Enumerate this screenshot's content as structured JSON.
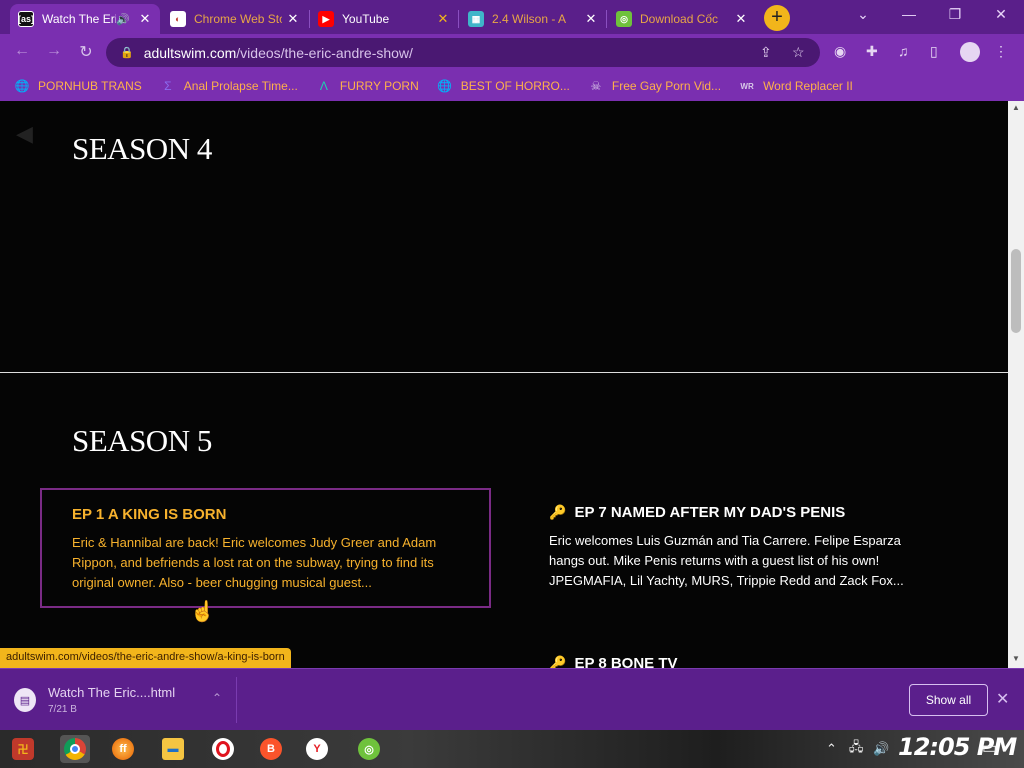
{
  "tabs": [
    {
      "title": "Watch The Eric Andre Show",
      "active": true,
      "favicon_text": "[as]",
      "favicon_color": "#111111"
    },
    {
      "title": "Chrome Web Store",
      "active": false,
      "favicon_color": "#ffffff"
    },
    {
      "title": "YouTube",
      "active": false,
      "favicon_color": "#ff0000"
    },
    {
      "title": "2.4 Wilson - A",
      "active": false,
      "favicon_color": "#3fb5c9"
    },
    {
      "title": "Download Cốc",
      "active": false,
      "favicon_color": "#6fc23c"
    }
  ],
  "toolbar": {
    "url_domain": "adultswim.com",
    "url_path": "/videos/the-eric-andre-show/"
  },
  "bookmarks": [
    {
      "label": "PORNHUB TRANS",
      "icon": "globe-icon"
    },
    {
      "label": "Anal Prolapse Time...",
      "icon": "bracket-icon"
    },
    {
      "label": "FURRY PORN",
      "icon": "lambda-icon"
    },
    {
      "label": "BEST OF HORRO...",
      "icon": "globe-icon"
    },
    {
      "label": "Free Gay Porn Vid...",
      "icon": "skull-icon"
    },
    {
      "label": "Word Replacer II",
      "icon": "wr-icon"
    }
  ],
  "page": {
    "season4_title": "SEASON 4",
    "season5_title": "SEASON 5",
    "episodes": [
      {
        "title": "EP 1 A KING IS BORN",
        "description": "Eric & Hannibal are back! Eric welcomes Judy Greer and Adam Rippon, and befriends a lost rat on the subway, trying to find its original owner. Also - beer chugging musical guest...",
        "selected": true,
        "locked": false
      },
      {
        "title": "EP 7 NAMED AFTER MY DAD'S PENIS",
        "description": "Eric welcomes Luis Guzmán and Tia Carrere. Felipe Esparza hangs out. Mike Penis returns with a guest list of his own! JPEGMAFIA, Lil Yachty, MURS, Trippie Redd and Zack Fox...",
        "selected": false,
        "locked": true
      },
      {
        "title": "EP 8 BONE TV",
        "description": "",
        "selected": false,
        "locked": true
      }
    ]
  },
  "status_link": "adultswim.com/videos/the-eric-andre-show/a-king-is-born",
  "download": {
    "filename": "Watch The Eric....html",
    "sub": "7/21 B",
    "show_all": "Show all"
  },
  "taskbar": {
    "apps": [
      "start-menu",
      "chrome",
      "firefox",
      "file-explorer",
      "opera",
      "brave",
      "yandex",
      "coc-coc"
    ],
    "clock": "12:05 PM"
  },
  "colors": {
    "tab_strip": "#5a1f8a",
    "toolbar": "#7a2fb0",
    "accent_orange": "#f7b22d",
    "selected_border": "#7a2b86",
    "status_bg": "#f2b51b"
  }
}
